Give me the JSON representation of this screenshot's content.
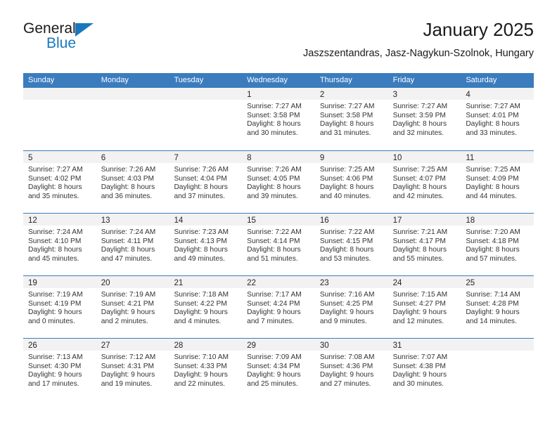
{
  "brand": {
    "line1": "General",
    "line2": "Blue",
    "triangle_icon": "triangle-logo-icon",
    "accent_color": "#1878be"
  },
  "header": {
    "title": "January 2025",
    "subtitle": "Jaszszentandras, Jasz-Nagykun-Szolnok, Hungary"
  },
  "calendar": {
    "header_bg": "#3a7cbe",
    "weekdays": [
      "Sunday",
      "Monday",
      "Tuesday",
      "Wednesday",
      "Thursday",
      "Friday",
      "Saturday"
    ],
    "weeks": [
      [
        {
          "day": "",
          "lines": []
        },
        {
          "day": "",
          "lines": []
        },
        {
          "day": "",
          "lines": []
        },
        {
          "day": "1",
          "lines": [
            "Sunrise: 7:27 AM",
            "Sunset: 3:58 PM",
            "Daylight: 8 hours",
            "and 30 minutes."
          ]
        },
        {
          "day": "2",
          "lines": [
            "Sunrise: 7:27 AM",
            "Sunset: 3:58 PM",
            "Daylight: 8 hours",
            "and 31 minutes."
          ]
        },
        {
          "day": "3",
          "lines": [
            "Sunrise: 7:27 AM",
            "Sunset: 3:59 PM",
            "Daylight: 8 hours",
            "and 32 minutes."
          ]
        },
        {
          "day": "4",
          "lines": [
            "Sunrise: 7:27 AM",
            "Sunset: 4:01 PM",
            "Daylight: 8 hours",
            "and 33 minutes."
          ]
        }
      ],
      [
        {
          "day": "5",
          "lines": [
            "Sunrise: 7:27 AM",
            "Sunset: 4:02 PM",
            "Daylight: 8 hours",
            "and 35 minutes."
          ]
        },
        {
          "day": "6",
          "lines": [
            "Sunrise: 7:26 AM",
            "Sunset: 4:03 PM",
            "Daylight: 8 hours",
            "and 36 minutes."
          ]
        },
        {
          "day": "7",
          "lines": [
            "Sunrise: 7:26 AM",
            "Sunset: 4:04 PM",
            "Daylight: 8 hours",
            "and 37 minutes."
          ]
        },
        {
          "day": "8",
          "lines": [
            "Sunrise: 7:26 AM",
            "Sunset: 4:05 PM",
            "Daylight: 8 hours",
            "and 39 minutes."
          ]
        },
        {
          "day": "9",
          "lines": [
            "Sunrise: 7:25 AM",
            "Sunset: 4:06 PM",
            "Daylight: 8 hours",
            "and 40 minutes."
          ]
        },
        {
          "day": "10",
          "lines": [
            "Sunrise: 7:25 AM",
            "Sunset: 4:07 PM",
            "Daylight: 8 hours",
            "and 42 minutes."
          ]
        },
        {
          "day": "11",
          "lines": [
            "Sunrise: 7:25 AM",
            "Sunset: 4:09 PM",
            "Daylight: 8 hours",
            "and 44 minutes."
          ]
        }
      ],
      [
        {
          "day": "12",
          "lines": [
            "Sunrise: 7:24 AM",
            "Sunset: 4:10 PM",
            "Daylight: 8 hours",
            "and 45 minutes."
          ]
        },
        {
          "day": "13",
          "lines": [
            "Sunrise: 7:24 AM",
            "Sunset: 4:11 PM",
            "Daylight: 8 hours",
            "and 47 minutes."
          ]
        },
        {
          "day": "14",
          "lines": [
            "Sunrise: 7:23 AM",
            "Sunset: 4:13 PM",
            "Daylight: 8 hours",
            "and 49 minutes."
          ]
        },
        {
          "day": "15",
          "lines": [
            "Sunrise: 7:22 AM",
            "Sunset: 4:14 PM",
            "Daylight: 8 hours",
            "and 51 minutes."
          ]
        },
        {
          "day": "16",
          "lines": [
            "Sunrise: 7:22 AM",
            "Sunset: 4:15 PM",
            "Daylight: 8 hours",
            "and 53 minutes."
          ]
        },
        {
          "day": "17",
          "lines": [
            "Sunrise: 7:21 AM",
            "Sunset: 4:17 PM",
            "Daylight: 8 hours",
            "and 55 minutes."
          ]
        },
        {
          "day": "18",
          "lines": [
            "Sunrise: 7:20 AM",
            "Sunset: 4:18 PM",
            "Daylight: 8 hours",
            "and 57 minutes."
          ]
        }
      ],
      [
        {
          "day": "19",
          "lines": [
            "Sunrise: 7:19 AM",
            "Sunset: 4:19 PM",
            "Daylight: 9 hours",
            "and 0 minutes."
          ]
        },
        {
          "day": "20",
          "lines": [
            "Sunrise: 7:19 AM",
            "Sunset: 4:21 PM",
            "Daylight: 9 hours",
            "and 2 minutes."
          ]
        },
        {
          "day": "21",
          "lines": [
            "Sunrise: 7:18 AM",
            "Sunset: 4:22 PM",
            "Daylight: 9 hours",
            "and 4 minutes."
          ]
        },
        {
          "day": "22",
          "lines": [
            "Sunrise: 7:17 AM",
            "Sunset: 4:24 PM",
            "Daylight: 9 hours",
            "and 7 minutes."
          ]
        },
        {
          "day": "23",
          "lines": [
            "Sunrise: 7:16 AM",
            "Sunset: 4:25 PM",
            "Daylight: 9 hours",
            "and 9 minutes."
          ]
        },
        {
          "day": "24",
          "lines": [
            "Sunrise: 7:15 AM",
            "Sunset: 4:27 PM",
            "Daylight: 9 hours",
            "and 12 minutes."
          ]
        },
        {
          "day": "25",
          "lines": [
            "Sunrise: 7:14 AM",
            "Sunset: 4:28 PM",
            "Daylight: 9 hours",
            "and 14 minutes."
          ]
        }
      ],
      [
        {
          "day": "26",
          "lines": [
            "Sunrise: 7:13 AM",
            "Sunset: 4:30 PM",
            "Daylight: 9 hours",
            "and 17 minutes."
          ]
        },
        {
          "day": "27",
          "lines": [
            "Sunrise: 7:12 AM",
            "Sunset: 4:31 PM",
            "Daylight: 9 hours",
            "and 19 minutes."
          ]
        },
        {
          "day": "28",
          "lines": [
            "Sunrise: 7:10 AM",
            "Sunset: 4:33 PM",
            "Daylight: 9 hours",
            "and 22 minutes."
          ]
        },
        {
          "day": "29",
          "lines": [
            "Sunrise: 7:09 AM",
            "Sunset: 4:34 PM",
            "Daylight: 9 hours",
            "and 25 minutes."
          ]
        },
        {
          "day": "30",
          "lines": [
            "Sunrise: 7:08 AM",
            "Sunset: 4:36 PM",
            "Daylight: 9 hours",
            "and 27 minutes."
          ]
        },
        {
          "day": "31",
          "lines": [
            "Sunrise: 7:07 AM",
            "Sunset: 4:38 PM",
            "Daylight: 9 hours",
            "and 30 minutes."
          ]
        },
        {
          "day": "",
          "lines": []
        }
      ]
    ]
  }
}
